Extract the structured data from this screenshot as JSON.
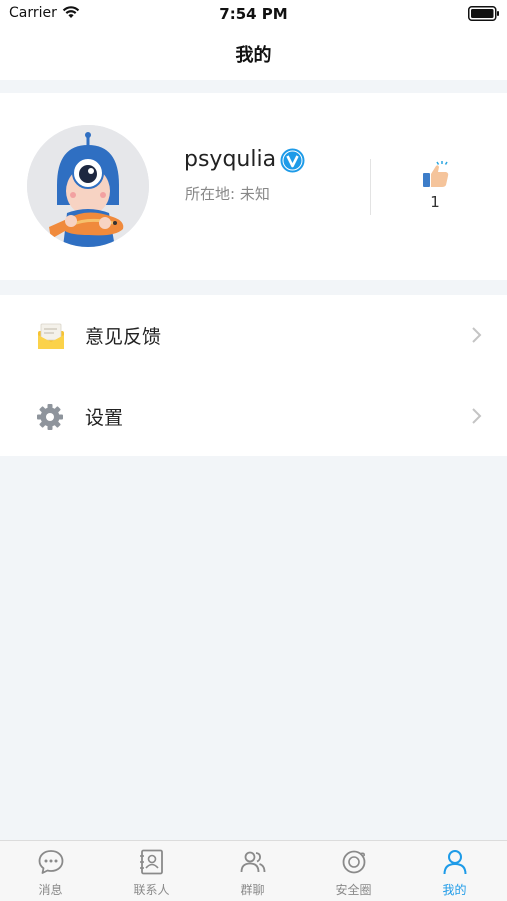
{
  "status_bar": {
    "carrier": "Carrier",
    "time": "7:54 PM"
  },
  "nav": {
    "title": "我的"
  },
  "profile": {
    "username": "psyqulia",
    "location": "所在地: 未知",
    "like_count": "1",
    "verified_icon": "verified-v-icon",
    "like_icon": "thumbs-up-icon"
  },
  "menu": [
    {
      "label": "意见反馈",
      "icon": "envelope-icon"
    },
    {
      "label": "设置",
      "icon": "gear-icon"
    }
  ],
  "tabs": [
    {
      "label": "消息",
      "icon": "chat-bubble-icon",
      "active": false
    },
    {
      "label": "联系人",
      "icon": "contacts-book-icon",
      "active": false
    },
    {
      "label": "群聊",
      "icon": "group-icon",
      "active": false
    },
    {
      "label": "安全圈",
      "icon": "planet-icon",
      "active": false
    },
    {
      "label": "我的",
      "icon": "person-icon",
      "active": true
    }
  ],
  "colors": {
    "accent": "#1e9be8",
    "background": "#f2f5f8",
    "inactive_tab": "#8a8a8a"
  }
}
